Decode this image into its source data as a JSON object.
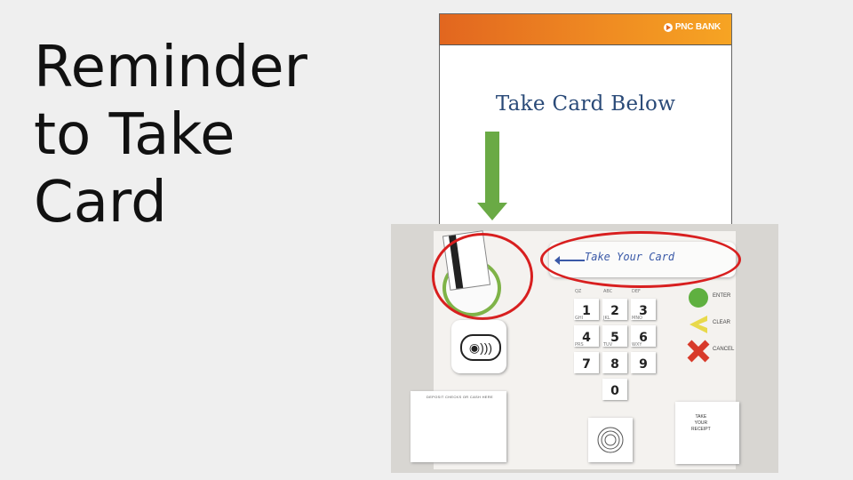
{
  "slide": {
    "title_lines": [
      "Reminder",
      "to Take",
      "Card"
    ]
  },
  "atm_screen": {
    "brand": "PNC BANK",
    "message": "Take Card Below",
    "header_gradient": [
      "#e2661f",
      "#f6a423"
    ],
    "message_color": "#2a4a78",
    "arrow_color": "#6aaa45",
    "arrow_direction": "down"
  },
  "prototype_photo": {
    "take_card_label": "Take Your Card",
    "highlight_color": "#d81f1f",
    "keypad": [
      {
        "digit": "1",
        "letters": "QZ"
      },
      {
        "digit": "2",
        "letters": "ABC"
      },
      {
        "digit": "3",
        "letters": "DEF"
      },
      {
        "digit": "4",
        "letters": "GHI"
      },
      {
        "digit": "5",
        "letters": "JKL"
      },
      {
        "digit": "6",
        "letters": "MNO"
      },
      {
        "digit": "7",
        "letters": "PRS"
      },
      {
        "digit": "8",
        "letters": "TUV"
      },
      {
        "digit": "9",
        "letters": "WXY"
      },
      {
        "digit": "0",
        "letters": ""
      }
    ],
    "function_keys": [
      {
        "label": "ENTER",
        "color": "#5fb040",
        "icon": "circle-icon"
      },
      {
        "label": "CLEAR",
        "color": "#e8d94a",
        "icon": "chevron-left-icon"
      },
      {
        "label": "CANCEL",
        "color": "#d83a2a",
        "icon": "x-icon"
      }
    ],
    "contactless_icon": "contactless-icon",
    "deposit_label": "DEPOSIT CHECKS OR CASH HERE",
    "receipt_label": [
      "TAKE",
      "YOUR",
      "RECEIPT"
    ]
  }
}
